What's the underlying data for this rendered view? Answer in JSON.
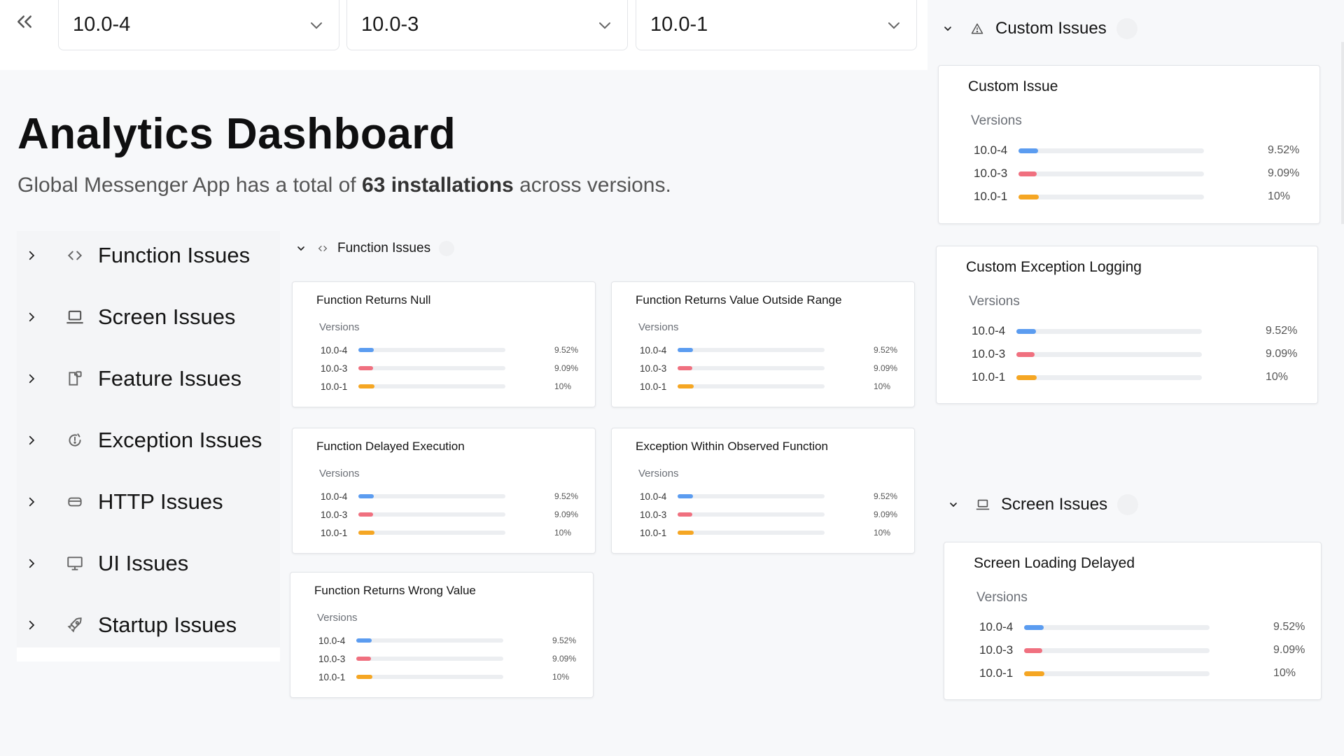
{
  "version_selects": [
    "10.0-4",
    "10.0-3",
    "10.0-1"
  ],
  "title": "Analytics Dashboard",
  "subtitle": {
    "prefix": "Global Messenger App has a total of",
    "highlight": "63 installations",
    "suffix": "across versions."
  },
  "sidebar": {
    "items": [
      {
        "label": "Function Issues",
        "icon": "code-icon"
      },
      {
        "label": "Screen Issues",
        "icon": "laptop-icon"
      },
      {
        "label": "Feature Issues",
        "icon": "feature-icon"
      },
      {
        "label": "Exception Issues",
        "icon": "exception-icon"
      },
      {
        "label": "HTTP Issues",
        "icon": "http-icon"
      },
      {
        "label": "UI Issues",
        "icon": "monitor-icon"
      },
      {
        "label": "Startup Issues",
        "icon": "rocket-icon"
      }
    ]
  },
  "versions_label": "Versions",
  "version_colors": {
    "10.0-4": "#5b9cf0",
    "10.0-3": "#f0707f",
    "10.0-1": "#f5a623"
  },
  "rows": [
    {
      "version": "10.0-4",
      "pct": "9.52%",
      "fill": 0.0952
    },
    {
      "version": "10.0-3",
      "pct": "9.09%",
      "fill": 0.0909
    },
    {
      "version": "10.0-1",
      "pct": "10%",
      "fill": 0.1
    }
  ],
  "function_group": {
    "title": "Function Issues",
    "cards": [
      "Function Returns Null",
      "Function Returns Value Outside Range",
      "Function Delayed Execution",
      "Exception Within Observed Function",
      "Function Returns Wrong Value"
    ]
  },
  "custom_group": {
    "title": "Custom Issues",
    "cards": [
      "Custom Issue",
      "Custom Exception Logging"
    ]
  },
  "screen_group": {
    "title": "Screen Issues",
    "cards": [
      "Screen Loading Delayed"
    ]
  }
}
